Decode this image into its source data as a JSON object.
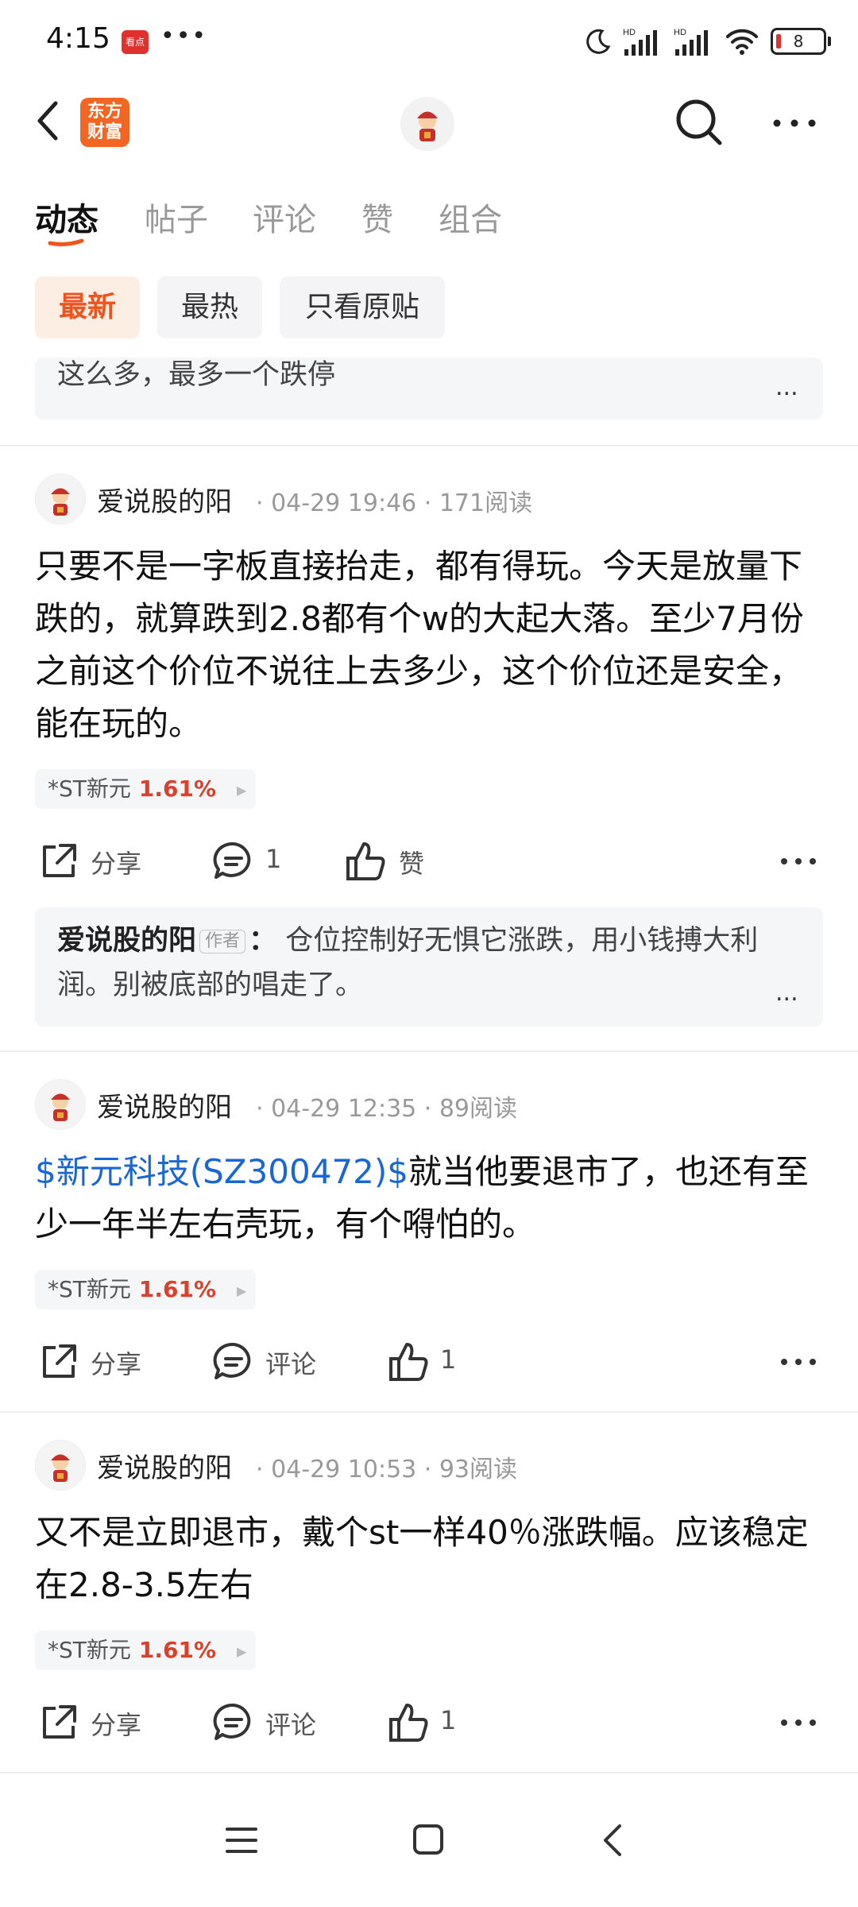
{
  "status_bar": {
    "time": "4:15",
    "app_badge": "看点",
    "battery": "8"
  },
  "nav": {
    "logo_line1": "东方",
    "logo_line2": "财富"
  },
  "tabs": [
    "动态",
    "帖子",
    "评论",
    "赞",
    "组合"
  ],
  "filters": [
    "最新",
    "最热",
    "只看原贴"
  ],
  "top_reply": {
    "text": "这么多，最多一个跌停",
    "more": "..."
  },
  "posts": [
    {
      "user": "爱说股的阳",
      "meta": "· 04-29 19:46 · 171阅读",
      "text": "只要不是一字板直接抬走，都有得玩。今天是放量下跌的，就算跌到2.8都有个w的大起大落。至少7月份之前这个价位不说往上去多少，这个价位还是安全，能在玩的。",
      "stock_name": "*ST新元",
      "stock_pct": "1.61%",
      "share": "分享",
      "comment": "1",
      "like": "赞",
      "reply": {
        "author": "爱说股的阳",
        "tag": "作者",
        "colon": "：",
        "text": "仓位控制好无惧它涨跌，用小钱搏大利润。别被底部的唱走了。",
        "more": "..."
      }
    },
    {
      "user": "爱说股的阳",
      "meta": "· 04-29 12:35 · 89阅读",
      "link": "$新元科技(SZ300472)$",
      "text": "就当他要退市了，也还有至少一年半左右壳玩，有个嘚怕的。",
      "stock_name": "*ST新元",
      "stock_pct": "1.61%",
      "share": "分享",
      "comment": "评论",
      "like": "1"
    },
    {
      "user": "爱说股的阳",
      "meta": "· 04-29 10:53 · 93阅读",
      "text": "又不是立即退市，戴个st一样40％涨跌幅。应该稳定在2.8-3.5左右",
      "stock_name": "*ST新元",
      "stock_pct": "1.61%",
      "share": "分享",
      "comment": "评论",
      "like": "1"
    }
  ],
  "colors": {
    "accent": "#f0541e",
    "link": "#1a66d4",
    "stock_up": "#d8412c"
  }
}
